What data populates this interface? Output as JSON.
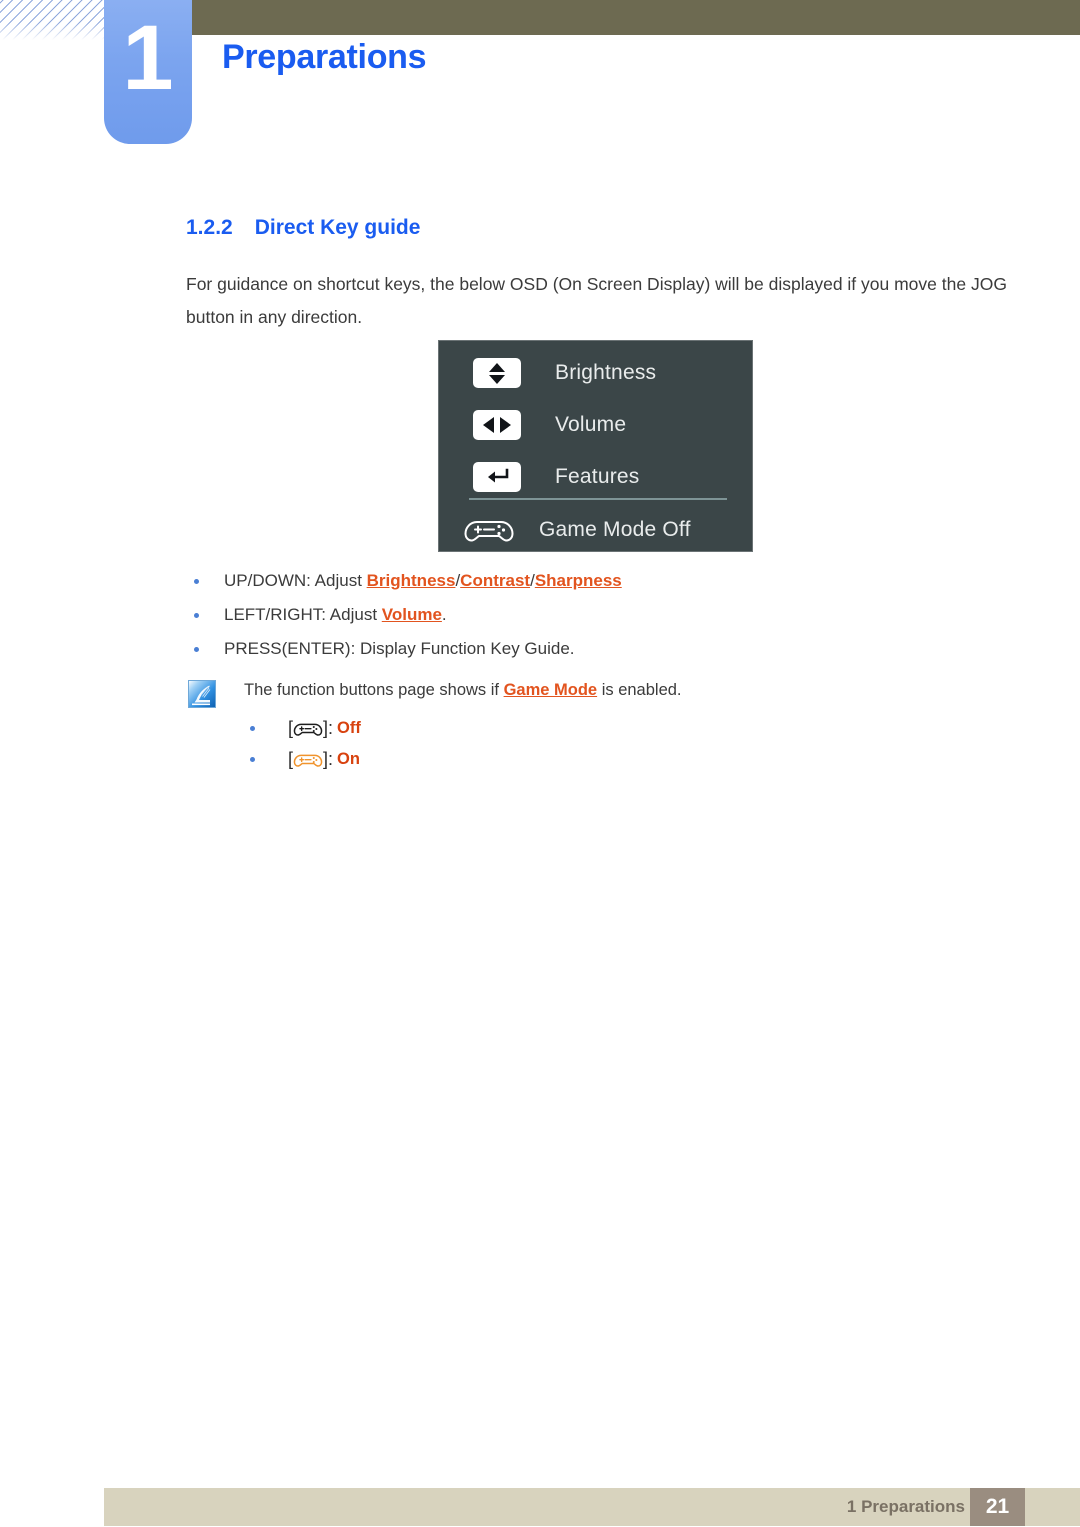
{
  "header": {
    "chapter_number": "1",
    "chapter_title": "Preparations",
    "hatch_icon": "diagonal-hatch-decoration"
  },
  "section": {
    "number": "1.2.2",
    "title": "Direct Key guide",
    "intro": "For guidance on shortcut keys, the below OSD (On Screen Display) will be displayed if you move the JOG button in any direction."
  },
  "osd": {
    "rows": [
      {
        "icon": "up-down-arrows-icon",
        "label": "Brightness"
      },
      {
        "icon": "left-right-arrows-icon",
        "label": "Volume"
      },
      {
        "icon": "enter-return-arrow-icon",
        "label": "Features"
      },
      {
        "icon": "gamepad-icon",
        "label": "Game Mode Off"
      }
    ],
    "background_color": "#3b4648",
    "text_color": "#e9ecec",
    "divider_color": "#7e9496"
  },
  "bullets": [
    {
      "prefix": "UP/DOWN: Adjust ",
      "highlights": [
        "Brightness",
        "Contrast",
        "Sharpness"
      ],
      "separators": [
        "/",
        "/"
      ],
      "suffix": ""
    },
    {
      "prefix": "LEFT/RIGHT: Adjust ",
      "highlights": [
        "Volume"
      ],
      "separators": [],
      "suffix": "."
    },
    {
      "prefix": "PRESS(ENTER): Display Function Key Guide.",
      "highlights": [],
      "separators": [],
      "suffix": ""
    }
  ],
  "note": {
    "icon": "note-quill-icon",
    "text_before": "The function buttons page shows if ",
    "highlight": "Game Mode",
    "text_after": " is enabled.",
    "items": [
      {
        "icon": "gamepad-icon-black",
        "bracket_open": "[",
        "bracket_close": "]:",
        "state": "Off",
        "state_color": "#d8420f"
      },
      {
        "icon": "gamepad-icon-orange",
        "bracket_open": "[",
        "bracket_close": "]:",
        "state": "On",
        "state_color": "#d8420f"
      }
    ]
  },
  "footer": {
    "label": "1 Preparations",
    "page_number": "21",
    "bar_color": "#d8d3be",
    "page_box_color": "#9a8d80"
  },
  "colors": {
    "brand_blue": "#1a5cf0",
    "accent_orange": "#e2541f",
    "olive": "#6d6a51",
    "tab_blue": "#7ba4ef"
  }
}
